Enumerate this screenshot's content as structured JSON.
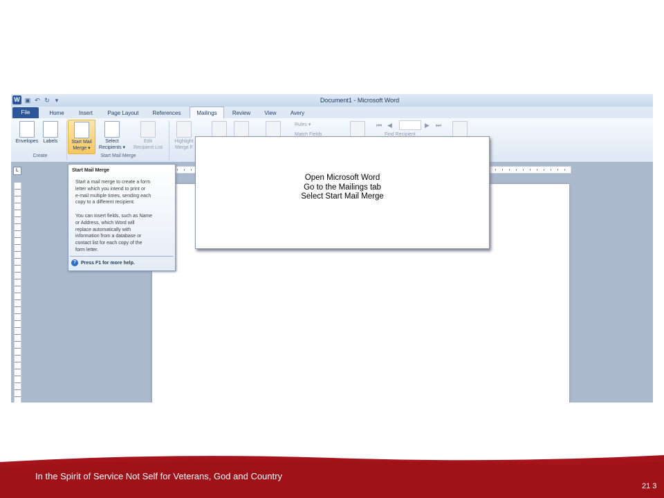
{
  "titlebar": {
    "app_icon_label": "W",
    "title": "Document1  -  Microsoft Word"
  },
  "tabs": [
    "File",
    "Home",
    "Insert",
    "Page Layout",
    "References",
    "Mailings",
    "Review",
    "View",
    "Avery"
  ],
  "active_tab": "Mailings",
  "ribbon": {
    "envelopes": "Envelopes",
    "labels": "Labels",
    "start_mail_merge_1": "Start Mail",
    "start_mail_merge_2": "Merge ▾",
    "select_recipients_1": "Select",
    "select_recipients_2": "Recipients ▾",
    "edit_recipient_list_1": "Edit",
    "edit_recipient_list_2": "Recipient List",
    "highlight_merge_fields_1": "Highlight",
    "highlight_merge_fields_2": "Merge F",
    "rules": "Rules ▾",
    "match_fields": "Match Fields",
    "find_recipient": "Find Recipient",
    "group_create": "Create",
    "group_start_mail_merge": "Start Mail Merge"
  },
  "ruler_corner": "L",
  "tooltip": {
    "title": "Start Mail Merge",
    "body": "Start a mail merge to create a form\nletter which you intend to print or\ne-mail multiple times, sending each\ncopy to a different recipient.\n\nYou can insert fields, such as Name\nor Address, which Word will\nreplace automatically with\ninformation from a database or\ncontact list for each copy of the\nform letter.",
    "help": "Press F1 for more help."
  },
  "callout": {
    "line1": "Open Microsoft Word",
    "line2": "Go to the Mailings tab",
    "line3": "Select Start Mail Merge"
  },
  "footer": {
    "text": "In the Spirit of Service Not Self  for Veterans, God and Country",
    "page_number": "21 3"
  },
  "colors": {
    "footer_red": "#a6141b",
    "file_tab": "#2b579a",
    "selected_button": "#f8c860"
  }
}
